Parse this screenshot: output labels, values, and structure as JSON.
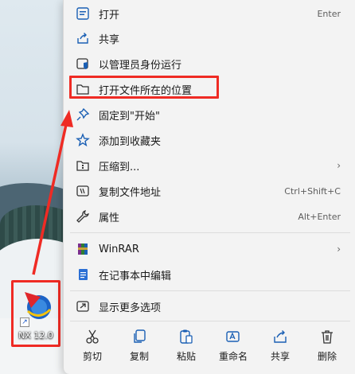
{
  "desktop": {
    "shortcut_label": "NX 12.0"
  },
  "menu": {
    "items": [
      {
        "label": "打开",
        "shortcut": "Enter",
        "icon": "open-icon"
      },
      {
        "label": "共享",
        "icon": "share-icon"
      },
      {
        "label": "以管理员身份运行",
        "icon": "shield-icon"
      },
      {
        "label": "打开文件所在的位置",
        "icon": "folder-icon"
      },
      {
        "label": "固定到\"开始\"",
        "icon": "pin-icon"
      },
      {
        "label": "添加到收藏夹",
        "icon": "star-icon"
      },
      {
        "label": "压缩到...",
        "icon": "zip-icon",
        "submenu": true
      },
      {
        "label": "复制文件地址",
        "shortcut": "Ctrl+Shift+C",
        "icon": "copy-path-icon"
      },
      {
        "label": "属性",
        "shortcut": "Alt+Enter",
        "icon": "wrench-icon"
      },
      {
        "label": "WinRAR",
        "icon": "winrar-icon",
        "submenu": true
      },
      {
        "label": "在记事本中编辑",
        "icon": "notepad-icon"
      },
      {
        "label": "显示更多选项",
        "icon": "more-options-icon"
      }
    ],
    "actions": [
      {
        "label": "剪切",
        "icon": "cut-icon"
      },
      {
        "label": "复制",
        "icon": "copy-icon"
      },
      {
        "label": "粘贴",
        "icon": "paste-icon"
      },
      {
        "label": "重命名",
        "icon": "rename-icon"
      },
      {
        "label": "共享",
        "icon": "share-icon"
      },
      {
        "label": "删除",
        "icon": "delete-icon"
      }
    ]
  },
  "colors": {
    "annotation_red": "#ef2b24",
    "menu_bg": "#f3f3f3",
    "icon_blue": "#1a5fb4"
  }
}
